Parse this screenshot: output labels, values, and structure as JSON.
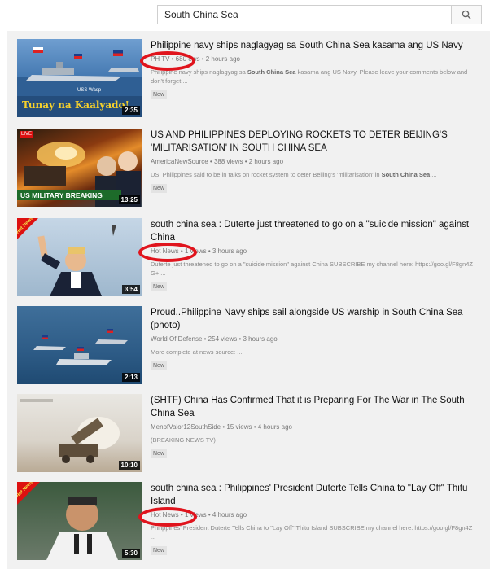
{
  "search": {
    "query": "South China Sea"
  },
  "videos": [
    {
      "title": "Philippine navy ships naglagyag sa South China Sea kasama ang US Navy",
      "channel": "PH TV",
      "channel_hidden": "680",
      "tail": "ews • 2 hours ago",
      "desc_pre": "Philippine navy ships naglagyag sa ",
      "desc_bold": "South China Sea",
      "desc_post": " kasama ang US Navy. Please leave your comments below and don't forget ...",
      "badge": "New",
      "duration": "2:35",
      "thumb_caption": "Tunay na Kaalyado!",
      "thumb_small": "USS Wasp"
    },
    {
      "title": "US AND PHILIPPINES DEPLOYING ROCKETS TO DETER BEIJING'S 'MILITARISATION' IN SOUTH CHINA SEA",
      "channel": "AmericaNewSource • 388 views • 2 hours ago",
      "desc_pre": "US, Philippines said to be in talks on rocket system to deter Beijing's 'militarisation' in ",
      "desc_bold": "South China Sea",
      "desc_post": " ...",
      "badge": "New",
      "duration": "13:25",
      "thumb_caption": "US MILITARY BREAKING",
      "thumb_live": "LIVE"
    },
    {
      "title": "south china sea : Duterte just threatened to go on a \"suicide mission\" against China",
      "channel": "Hot News",
      "tail": "• 1 views • 3 hours ago",
      "desc_pre": "Duterte just threatened to go on a \"suicide mission\" against China SUBSCRIBE my channel here: https://goo.gl/F8gn4Z G+ ...",
      "desc_bold": "",
      "desc_post": "",
      "badge": "New",
      "duration": "3:54",
      "thumb_ribbon": "Hot News"
    },
    {
      "title": "Proud..Philippine Navy ships sail alongside US warship in South China Sea (photo)",
      "channel": "World Of Defense • 254 views • 3 hours ago",
      "desc_pre": "More complete at news source: ...",
      "desc_bold": "",
      "desc_post": "",
      "badge": "New",
      "duration": "2:13"
    },
    {
      "title": "(SHTF) China Has Confirmed That it is Preparing For The War in The South China Sea",
      "channel": "MenofValor12SouthSide • 15 views • 4 hours ago",
      "desc_pre": "(BREAKING NEWS TV)",
      "desc_bold": "",
      "desc_post": "",
      "badge": "New",
      "duration": "10:10"
    },
    {
      "title": "south china sea : Philippines' President Duterte Tells China to \"Lay Off\" Thitu Island",
      "channel": "Hot News",
      "tail": "• 1 views • 4 hours ago",
      "desc_pre": "Philippines' President Duterte Tells China to \"Lay Off\" Thitu Island SUBSCRIBE my channel here: https://goo.gl/F8gn4Z ...",
      "desc_bold": "",
      "desc_post": "",
      "badge": "New",
      "duration": "5:30",
      "thumb_ribbon": "Hot News"
    }
  ],
  "colors": {
    "annotation": "#e0141d",
    "background": "#f1f1f1"
  },
  "icons": {
    "search": "search-icon"
  }
}
